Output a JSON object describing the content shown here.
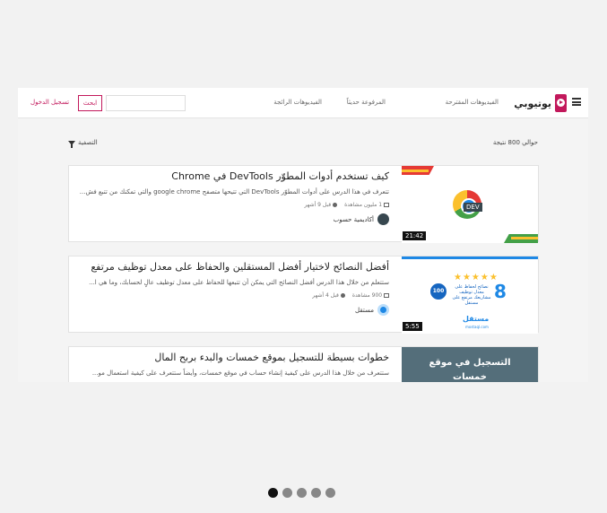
{
  "header": {
    "logo_text": "يوتيوبي",
    "nav": [
      "الفيديوهات المقترحة",
      "المرفوعة حديثاً",
      "الفيديوهات الرائجة"
    ],
    "search_placeholder": "",
    "search_button": "ابحث",
    "login": "تسجيل الدخول"
  },
  "results": {
    "count_label": "حوالي 800 نتيجة",
    "filter_label": "التصفية"
  },
  "videos": [
    {
      "title": "كيف تستخدم أدوات المطوّر DevTools في Chrome",
      "description": "تتعرف في هذا الدرس على أدوات المطوّر DevTools التي تتيحها متصفح google chrome والتي تمكنك من تتبع فش...",
      "views": "1 مليون مشاهدة",
      "age": "قبل 9 أشهر",
      "channel": "أكاديمية حسوب",
      "duration": "21:42",
      "thumb_tag": "DEV"
    },
    {
      "title": "أفضل النصائح لاختيار أفضل المستقلين والحفاظ على معدل توظيف مرتفع",
      "description": "ستتعلم من خلال هذا الدرس أفضل النصائح التي يمكن أن تتبعها للحفاظ على معدل توظيف عالٍ لحسابك، وما هي ا...",
      "views": "900 مشاهدة",
      "age": "قبل 4 أشهر",
      "channel": "مستقل",
      "duration": "5:55",
      "thumb_badge": "100",
      "thumb_number": "8",
      "thumb_text": "نصائح لحفاظ على معدل توظيف مشاريعك مرتفع على مستقل",
      "thumb_logo": "مستقل",
      "thumb_logo_sub": "mostaql.com"
    },
    {
      "title": "خطوات بسيطة للتسجيل بموقع خمسات والبدء بربح المال",
      "description": "ستتعرف من خلال هذا الدرس على كيفية إنشاء حساب في موقع خمسات، وأيضاً ستتعرف على كيفية استعمال مو...",
      "thumb_line1": "التسجيل في موقع",
      "thumb_line2": "خمسات"
    }
  ],
  "pager": {
    "count": 5,
    "active": 0
  },
  "colors": {
    "accent": "#c2185b",
    "header_bg": "#ffffff",
    "page_bg": "#f2f2f2"
  }
}
